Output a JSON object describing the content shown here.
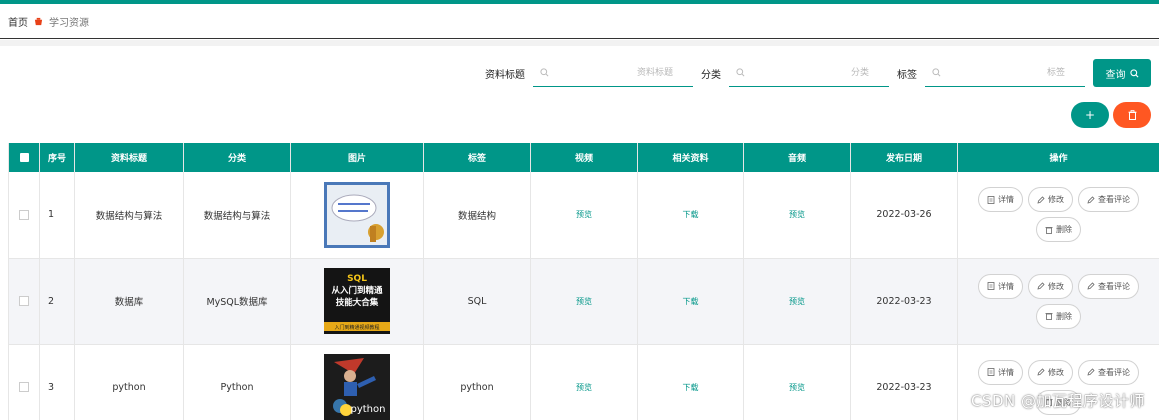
{
  "breadcrumb": {
    "home": "首页",
    "current": "学习资源"
  },
  "search": {
    "fields": [
      {
        "label": "资料标题",
        "placeholder": "资料标题",
        "value": ""
      },
      {
        "label": "分类",
        "placeholder": "分类",
        "value": ""
      },
      {
        "label": "标签",
        "placeholder": "标签",
        "value": ""
      }
    ],
    "query_label": "查询"
  },
  "actions": {
    "add_label": "+"
  },
  "table": {
    "headers": [
      "序号",
      "资料标题",
      "分类",
      "图片",
      "标签",
      "视频",
      "相关资料",
      "音频",
      "发布日期",
      "操作"
    ],
    "rows": [
      {
        "seq": "1",
        "title": "数据结构与算法",
        "category": "数据结构与算法",
        "tag": "数据结构",
        "video": "预览",
        "material": "下载",
        "audio": "预览",
        "date": "2022-03-26",
        "image": "data-structure-cover"
      },
      {
        "seq": "2",
        "title": "数据库",
        "category": "MySQL数据库",
        "tag": "SQL",
        "video": "预览",
        "material": "下载",
        "audio": "预览",
        "date": "2022-03-23",
        "image": "sql-cover"
      },
      {
        "seq": "3",
        "title": "python",
        "category": "Python",
        "tag": "python",
        "video": "预览",
        "material": "下载",
        "audio": "预览",
        "date": "2022-03-23",
        "image": "python-cover"
      }
    ],
    "op_labels": {
      "detail": "详情",
      "edit": "修改",
      "comments": "查看评论",
      "delete": "删除"
    }
  },
  "thumb_text": {
    "sql": {
      "line1": "SQL",
      "line2": "从入门到精通",
      "line3": "技能大合集",
      "banner": "入门到精通视频教程"
    },
    "python": {
      "word": "python"
    }
  },
  "watermark": "CSDN @加瓦程序设计师",
  "colors": {
    "accent": "#009688",
    "danger": "#ff5722"
  }
}
